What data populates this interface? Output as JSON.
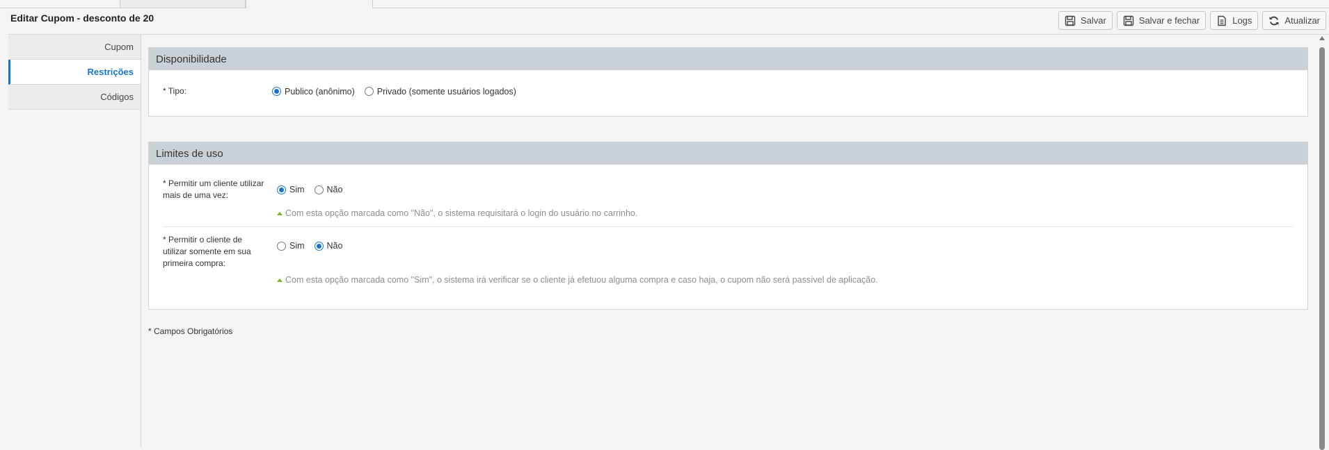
{
  "page": {
    "title": "Editar Cupom - desconto de 20"
  },
  "toolbar": {
    "save": {
      "label": "Salvar",
      "icon": "save-icon"
    },
    "save_close": {
      "label": "Salvar e fechar",
      "icon": "save-icon"
    },
    "logs": {
      "label": "Logs",
      "icon": "document-icon"
    },
    "refresh": {
      "label": "Atualizar",
      "icon": "refresh-icon"
    }
  },
  "sidebar": {
    "items": [
      {
        "label": "Cupom",
        "active": false
      },
      {
        "label": "Restrições",
        "active": true
      },
      {
        "label": "Códigos",
        "active": false
      }
    ]
  },
  "availability": {
    "title": "Disponibilidade",
    "type_label": "* Tipo:",
    "options": [
      {
        "label": "Publico (anônimo)",
        "selected": true
      },
      {
        "label": "Privado (somente usuários logados)",
        "selected": false
      }
    ]
  },
  "usage_limits": {
    "title": "Limites de uso",
    "multi_use": {
      "label": "* Permitir um cliente utilizar mais de uma vez:",
      "options": [
        {
          "label": "Sim",
          "selected": true
        },
        {
          "label": "Não",
          "selected": false
        }
      ],
      "hint": "Com esta opção marcada como \"Não\", o sistema requisitará o login do usuário no carrinho."
    },
    "first_purchase": {
      "label": "* Permitir o cliente de utilizar somente em sua primeira compra:",
      "options": [
        {
          "label": "Sim",
          "selected": false
        },
        {
          "label": "Não",
          "selected": true
        }
      ],
      "hint": "Com esta opção marcada como \"Sim\", o sistema irá verificar se o cliente já efetuou alguma compra e caso haja, o cupom não será passível de aplicação."
    }
  },
  "footnote": "* Campos Obrigatórios",
  "colors": {
    "accent": "#1677c8",
    "panel_header": "#c9d0d6",
    "hint_marker": "#7ab31e"
  }
}
